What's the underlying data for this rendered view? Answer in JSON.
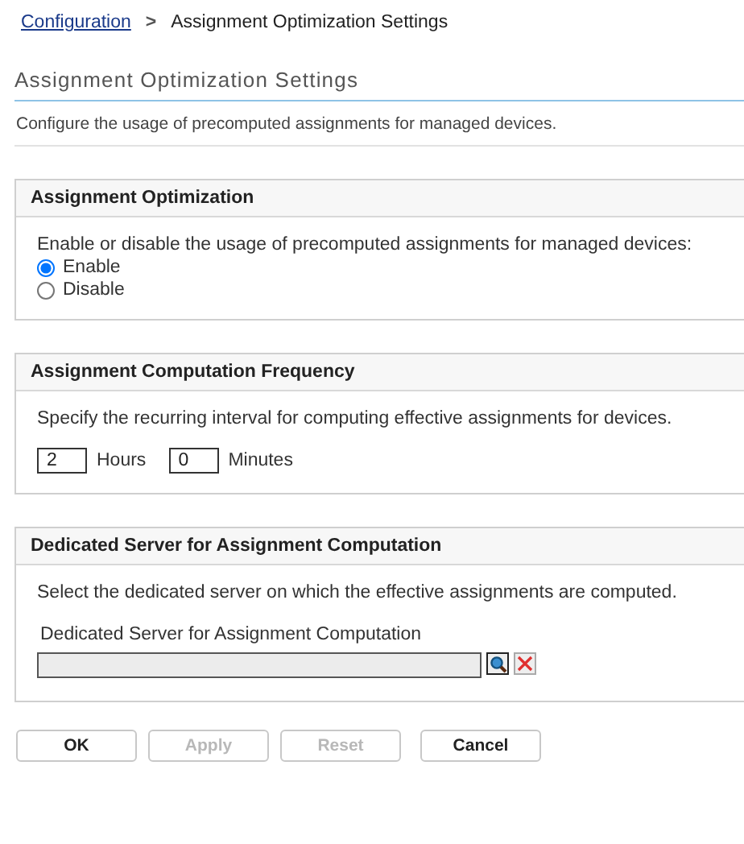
{
  "breadcrumb": {
    "link": "Configuration",
    "separator": ">",
    "current": "Assignment Optimization Settings"
  },
  "page_title": "Assignment Optimization Settings",
  "description": "Configure the usage of precomputed assignments for managed devices.",
  "sections": [
    {
      "kind": "radio",
      "title": "Assignment Optimization",
      "text": "Enable or disable the usage of precomputed assignments for managed devices:",
      "options": [
        {
          "label": "Enable",
          "selected": true
        },
        {
          "label": "Disable",
          "selected": false
        }
      ]
    },
    {
      "kind": "interval",
      "title": "Assignment Computation Frequency",
      "text": "Specify the recurring interval for computing effective assignments for devices.",
      "hours": {
        "value": "2",
        "unit": "Hours"
      },
      "minutes": {
        "value": "0",
        "unit": "Minutes"
      }
    },
    {
      "kind": "server",
      "title": "Dedicated Server for Assignment Computation",
      "text": "Select the dedicated server on which the effective assignments are computed.",
      "field_label": "Dedicated Server for Assignment Computation"
    }
  ],
  "buttons": [
    {
      "label": "OK",
      "disabled": false
    },
    {
      "label": "Apply",
      "disabled": true
    },
    {
      "label": "Reset",
      "disabled": true
    },
    {
      "label": "Cancel",
      "disabled": false
    }
  ]
}
